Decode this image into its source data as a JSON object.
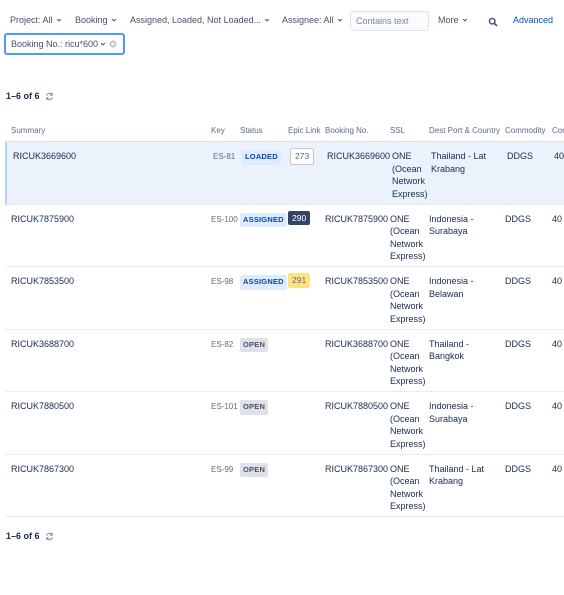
{
  "filters": {
    "project": "Project: All",
    "booking": "Booking",
    "status": "Assigned, Loaded, Not Loaded...",
    "assignee": "Assignee: All",
    "search_placeholder": "Contains text",
    "more": "More",
    "advanced": "Advanced"
  },
  "active_filter": {
    "label": "Booking No.: ricu*600"
  },
  "pagination": {
    "top": "1–6 of 6",
    "bottom": "1–6 of 6"
  },
  "columns": [
    "Summary",
    "Key",
    "Status",
    "Epic Link",
    "Booking No.",
    "SSL",
    "Dest Port & Country",
    "Commodity",
    "Con"
  ],
  "rows": [
    {
      "summary": "RICUK3669600",
      "key": "ES-81",
      "status": "LOADED",
      "status_type": "loaded",
      "epic": "273",
      "epic_style": "outline",
      "booking": "RICUK3669600",
      "ssl": "ONE (Ocean Network Express)",
      "dest": "Thailand - Lat Krabang",
      "commodity": "DDGS",
      "con": "40",
      "selected": true
    },
    {
      "summary": "RICUK7875900",
      "key": "ES-100",
      "status": "ASSIGNED",
      "status_type": "assigned",
      "epic": "290",
      "epic_style": "dark",
      "booking": "RICUK7875900",
      "ssl": "ONE (Ocean Network Express)",
      "dest": "Indonesia - Surabaya",
      "commodity": "DDGS",
      "con": "40",
      "selected": false
    },
    {
      "summary": "RICUK7853500",
      "key": "ES-98",
      "status": "ASSIGNED",
      "status_type": "assigned",
      "epic": "291",
      "epic_style": "yellow",
      "booking": "RICUK7853500",
      "ssl": "ONE (Ocean Network Express)",
      "dest": "Indonesia - Belawan",
      "commodity": "DDGS",
      "con": "40",
      "selected": false
    },
    {
      "summary": "RICUK3688700",
      "key": "ES-82",
      "status": "OPEN",
      "status_type": "open",
      "epic": "",
      "epic_style": "",
      "booking": "RICUK3688700",
      "ssl": "ONE (Ocean Network Express)",
      "dest": "Thailand - Bangkok",
      "commodity": "DDGS",
      "con": "40",
      "selected": false
    },
    {
      "summary": "RICUK7880500",
      "key": "ES-101",
      "status": "OPEN",
      "status_type": "open",
      "epic": "",
      "epic_style": "",
      "booking": "RICUK7880500",
      "ssl": "ONE (Ocean Network Express)",
      "dest": "Indonesia - Surabaya",
      "commodity": "DDGS",
      "con": "40",
      "selected": false
    },
    {
      "summary": "RICUK7867300",
      "key": "ES-99",
      "status": "OPEN",
      "status_type": "open",
      "epic": "",
      "epic_style": "",
      "booking": "RICUK7867300",
      "ssl": "ONE (Ocean Network Express)",
      "dest": "Thailand - Lat Krabang",
      "commodity": "DDGS",
      "con": "40",
      "selected": false
    }
  ]
}
